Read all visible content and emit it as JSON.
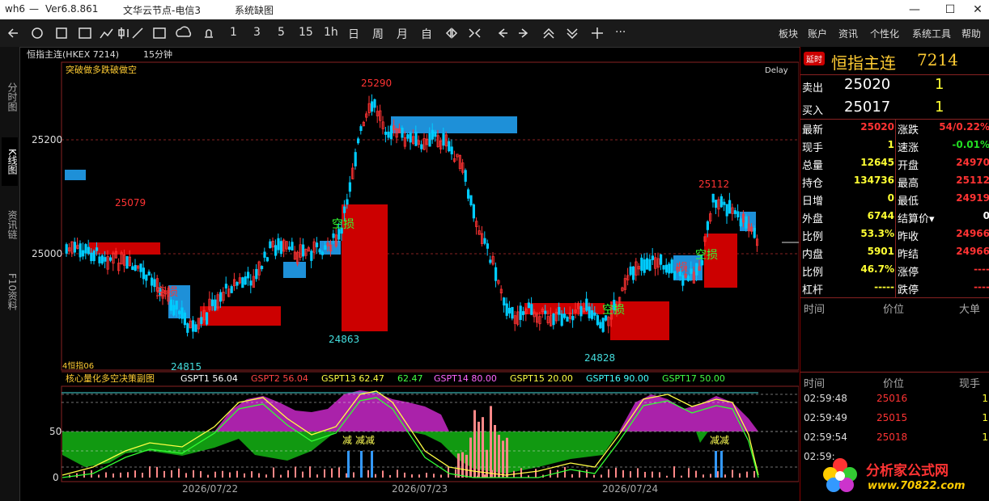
{
  "window": {
    "app": "wh6",
    "sep": "—",
    "version": "Ver6.8.861",
    "server": "文华云节点-电信3",
    "system_menu": "系统缺图",
    "btn_min": "—",
    "btn_max": "☐",
    "btn_close": "✕"
  },
  "toolbar": {
    "periods": [
      "1",
      "3",
      "5",
      "15",
      "1h",
      "日",
      "周",
      "月",
      "自"
    ],
    "menus": [
      "板块",
      "账户",
      "资讯",
      "个性化",
      "系统工具",
      "帮助"
    ],
    "more": "···"
  },
  "left_tabs": [
    {
      "label": "分时图",
      "active": false
    },
    {
      "label": "K线图",
      "active": true
    },
    {
      "label": "资讯链",
      "active": false
    },
    {
      "label": "F10资料",
      "active": false
    }
  ],
  "chart": {
    "symbol_label": "恒指主连(HKEX 7214)",
    "period_label": "15分钟",
    "indicator_main": "突破做多跌破做空",
    "delay": "Delay",
    "price_ticks": [
      "25200",
      "25000"
    ],
    "annotations": {
      "high1": "25079",
      "high2": "25290",
      "high3": "25112",
      "low1": "24815",
      "low2": "24863",
      "low3": "24828"
    },
    "signals": {
      "sig1": "空损",
      "sig2": "空损",
      "sig3": "空损",
      "sig4": "空损",
      "sig5": "损"
    },
    "small_label": "4恒指06",
    "sub_indicator": "核心量化多空决策副图",
    "sub_params": [
      {
        "text": "GSPT1 56.04",
        "color": "#ffffff"
      },
      {
        "text": "GSPT2 56.04",
        "color": "#ff4444"
      },
      {
        "text": "GSPT13 62.47",
        "color": "#ffff44"
      },
      {
        "text": "62.47",
        "color": "#44ff44"
      },
      {
        "text": "GSPT14 80.00",
        "color": "#ff66ff"
      },
      {
        "text": "GSPT15 20.00",
        "color": "#ffff44"
      },
      {
        "text": "GSPT16 90.00",
        "color": "#44ffff"
      },
      {
        "text": "GSPT17 50.00",
        "color": "#44ff44"
      }
    ],
    "sub_ticks": [
      "50",
      "0"
    ],
    "sub_texts": {
      "t1": "减",
      "t2": "减减",
      "t3": "减减"
    },
    "dates": [
      "2026/07/22",
      "2026/07/23",
      "2026/07/24"
    ]
  },
  "quote": {
    "badge": "延时",
    "title": "恒指主连",
    "code": "7214",
    "sell_label": "卖出",
    "sell_price": "25020",
    "sell_vol": "1",
    "buy_label": "买入",
    "buy_price": "25017",
    "buy_vol": "1",
    "stats": [
      [
        "最新",
        "25020",
        "涨跌",
        "54/0.22%"
      ],
      [
        "现手",
        "1",
        "速涨",
        "-0.01%"
      ],
      [
        "总量",
        "12645",
        "开盘",
        "24970"
      ],
      [
        "持仓",
        "134736",
        "最高",
        "25112"
      ],
      [
        "日增",
        "0",
        "最低",
        "24919"
      ],
      [
        "外盘",
        "6744",
        "结算价▾",
        "0"
      ],
      [
        "比例",
        "53.3%",
        "昨收",
        "24966"
      ],
      [
        "内盘",
        "5901",
        "昨结",
        "24966"
      ],
      [
        "比例",
        "46.7%",
        "涨停",
        "----"
      ],
      [
        "杠杆",
        "-----",
        "跌停",
        "----"
      ]
    ],
    "sec1_headers": [
      "时间",
      "价位",
      "大单"
    ],
    "sec2_headers": [
      "时间",
      "价位",
      "现手"
    ],
    "ticks": [
      {
        "time": "02:59:48",
        "price": "25016",
        "vol": "1"
      },
      {
        "time": "02:59:49",
        "price": "25015",
        "vol": "1"
      },
      {
        "time": "02:59:54",
        "price": "25018",
        "vol": "1"
      },
      {
        "time": "02:59:",
        "price": "",
        "vol": ""
      }
    ]
  },
  "watermark": {
    "brand": "分析家公式网",
    "url": "www.70822.com"
  },
  "colors": {
    "up": "#ff3333",
    "down": "#00ccff",
    "red_box": "#cc0000",
    "blue_box": "#1e90d8",
    "magenta": "#aa22aa",
    "green_fill": "#119911"
  }
}
